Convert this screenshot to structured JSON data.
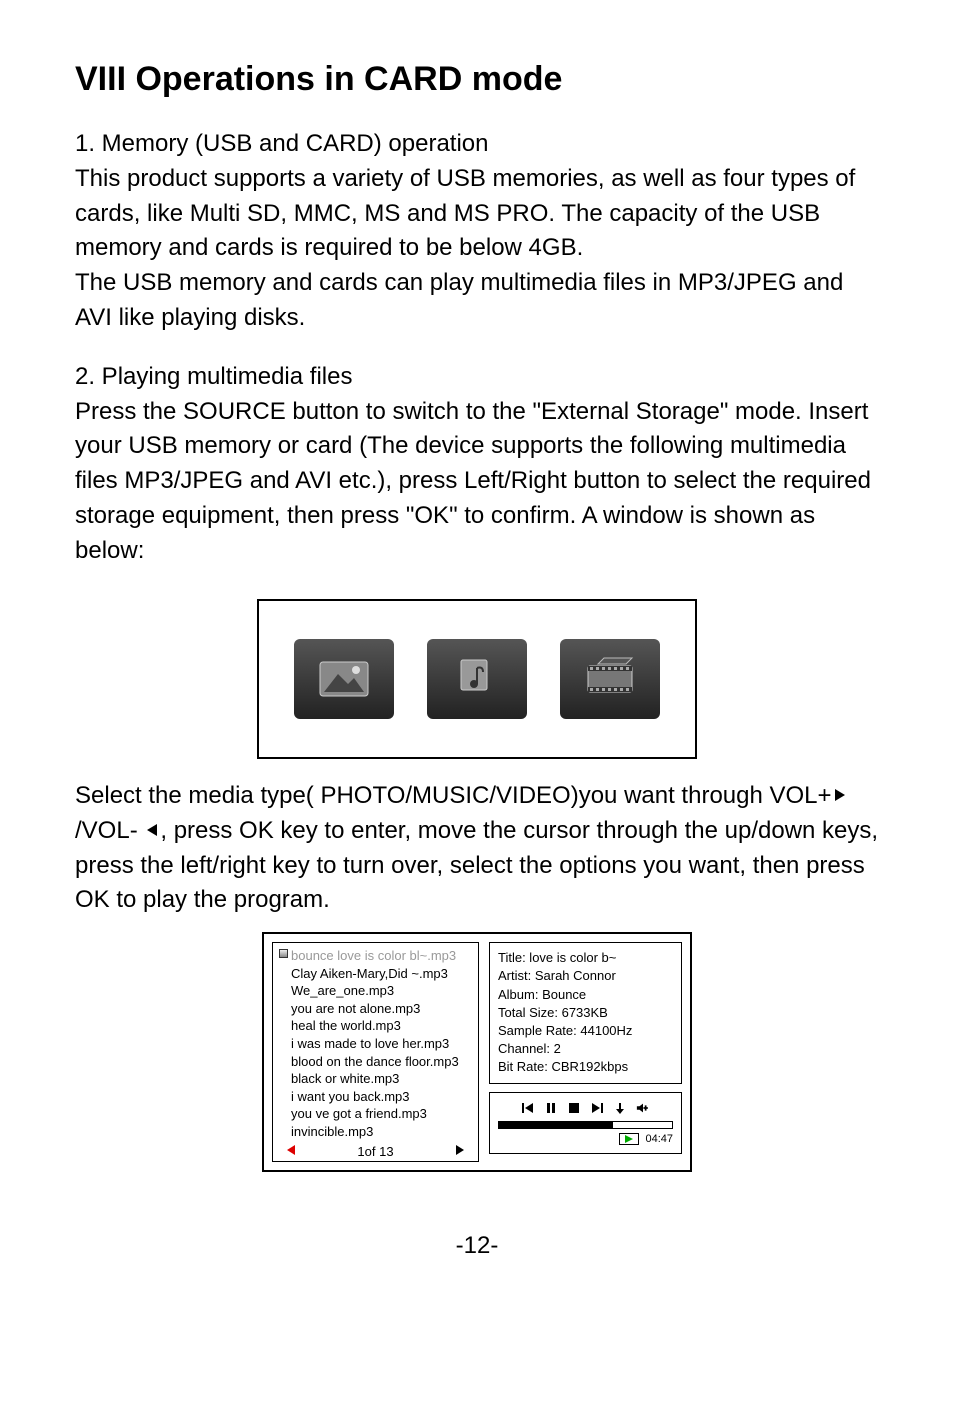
{
  "heading": "VIII  Operations in CARD mode",
  "section1": {
    "title": "1. Memory (USB and CARD) operation",
    "p1": "This product supports a variety of USB memories, as well as four types of cards, like Multi SD, MMC, MS and MS PRO. The capacity of the USB memory and cards is required to be below 4GB.",
    "p2": "The USB memory and cards can play multimedia files in MP3/JPEG and AVI like playing disks."
  },
  "section2": {
    "title": "2. Playing multimedia files",
    "p1": "Press the SOURCE button to switch to the \"External Storage\" mode. Insert your USB memory or card (The device supports the following multimedia files MP3/JPEG and AVI etc.), press Left/Right button to select the required storage equipment, then press \"OK\" to confirm. A window is shown as below:"
  },
  "media_select_text_pre": "Select the media type( PHOTO/MUSIC/VIDEO)you want through VOL+",
  "media_select_text_mid": "/VOL- ",
  "media_select_text_post": ", press OK key to enter, move the cursor through the up/down keys, press the left/right key to turn over, select the options you want, then press OK to play the program.",
  "file_list": [
    "bounce love is color bl~.mp3",
    "Clay Aiken-Mary,Did ~.mp3",
    "We_are_one.mp3",
    "you are not alone.mp3",
    "heal the world.mp3",
    "i was made to love her.mp3",
    "blood on the dance floor.mp3",
    "black or white.mp3",
    "i want you back.mp3",
    "you ve got a friend.mp3",
    "invincible.mp3"
  ],
  "pager_label": "1of 13",
  "info": {
    "title": "Title: love is color b~",
    "artist": "Artist: Sarah Connor",
    "album": "Album: Bounce",
    "size": "Total Size: 6733KB",
    "sample": "Sample Rate: 44100Hz",
    "channel": "Channel: 2",
    "bitrate": "Bit Rate: CBR192kbps"
  },
  "time": "04:47",
  "page_number": "-12-"
}
